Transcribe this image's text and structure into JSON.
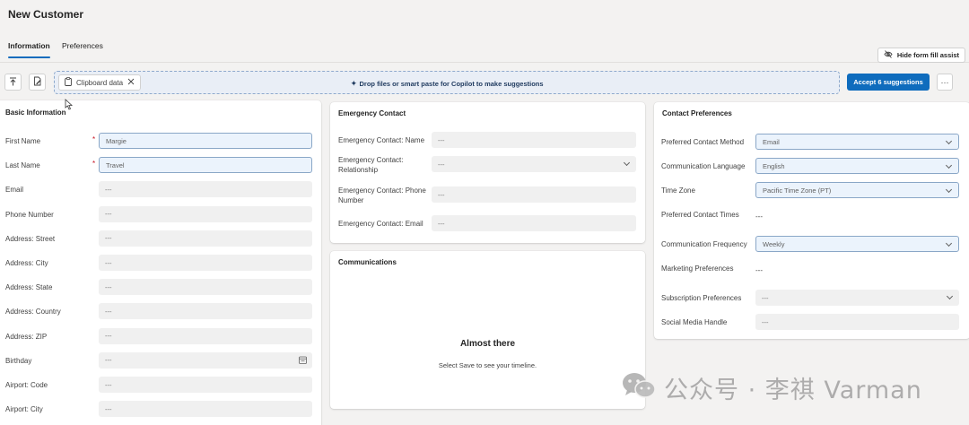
{
  "header": {
    "title": "New Customer",
    "tabs": [
      {
        "label": "Information",
        "active": true
      },
      {
        "label": "Preferences",
        "active": false
      }
    ],
    "hide_assist_label": "Hide form fill assist"
  },
  "toolbar": {
    "clipboard_chip": "Clipboard data",
    "drop_text": "Drop files or smart paste for Copilot to make suggestions",
    "accept_label": "Accept 6 suggestions",
    "more_label": "···"
  },
  "basic": {
    "title": "Basic Information",
    "fields": [
      {
        "label": "First Name",
        "value": "Margie",
        "required": true
      },
      {
        "label": "Last Name",
        "value": "Travel",
        "required": true
      },
      {
        "label": "Email",
        "value": "---"
      },
      {
        "label": "Phone Number",
        "value": "---"
      },
      {
        "label": "Address: Street",
        "value": "---"
      },
      {
        "label": "Address: City",
        "value": "---"
      },
      {
        "label": "Address: State",
        "value": "---"
      },
      {
        "label": "Address: Country",
        "value": "---"
      },
      {
        "label": "Address: ZIP",
        "value": "---"
      },
      {
        "label": "Birthday",
        "value": "---"
      },
      {
        "label": "Airport: Code",
        "value": "---"
      },
      {
        "label": "Airport: City",
        "value": "---"
      }
    ]
  },
  "emergency": {
    "title": "Emergency Contact",
    "fields": [
      {
        "label": "Emergency Contact: Name",
        "value": "---"
      },
      {
        "label": "Emergency Contact: Relationship",
        "value": "---"
      },
      {
        "label": "Emergency Contact: Phone Number",
        "value": "---"
      },
      {
        "label": "Emergency Contact: Email",
        "value": "---"
      }
    ]
  },
  "communications": {
    "title": "Communications",
    "empty_title": "Almost there",
    "empty_hint": "Select Save to see your timeline."
  },
  "contact_prefs": {
    "title": "Contact Preferences",
    "fields": [
      {
        "label": "Preferred Contact Method",
        "value": "Email"
      },
      {
        "label": "Communication Language",
        "value": "English"
      },
      {
        "label": "Time Zone",
        "value": "Pacific Time Zone (PT)"
      },
      {
        "label": "Preferred Contact Times",
        "value": "---"
      },
      {
        "label": "Communication Frequency",
        "value": "Weekly"
      },
      {
        "label": "Marketing Preferences",
        "value": "---"
      },
      {
        "label": "Subscription Preferences",
        "value": "---"
      },
      {
        "label": "Social Media Handle",
        "value": "---"
      }
    ]
  },
  "watermark": {
    "text": "公众号 · 李祺 Varman",
    "icon": "wechat-icon"
  },
  "colors": {
    "accent": "#0f6cbd",
    "required": "#c50f1f",
    "suggestion_fill": "#ebf3fc"
  }
}
